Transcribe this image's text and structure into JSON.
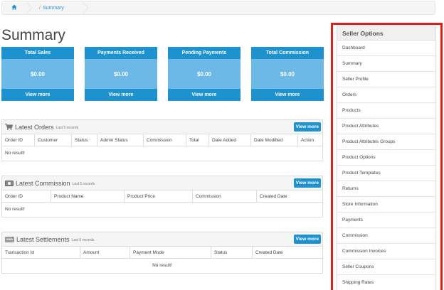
{
  "breadcrumb": {
    "current": "Summary",
    "separator": "/"
  },
  "page": {
    "title": "Summary"
  },
  "tiles": [
    {
      "title": "Total Sales",
      "value": "$0.00",
      "link": "View more"
    },
    {
      "title": "Payments Received",
      "value": "$0.00",
      "link": "View more"
    },
    {
      "title": "Pending Payments",
      "value": "$0.00",
      "link": "View more"
    },
    {
      "title": "Total Commission",
      "value": "$0.00",
      "link": "View more"
    }
  ],
  "orders": {
    "title": "Latest Orders",
    "subtitle": "Last 5 records",
    "button": "View more",
    "columns": [
      "Order ID",
      "Customer",
      "Status",
      "Admin Status",
      "Commission",
      "Total",
      "Date Added",
      "Date Modified",
      "Action"
    ],
    "empty": "No result!"
  },
  "commission": {
    "title": "Latest Commission",
    "subtitle": "Last 5 records",
    "button": "View more",
    "columns": [
      "Order ID",
      "Product Name",
      "Product Price",
      "Commission",
      "Created Date"
    ],
    "empty": "No result!"
  },
  "settlements": {
    "title": "Latest Settlements",
    "subtitle": "Last 5 records",
    "button": "View more",
    "icon_text": "VISA",
    "columns": [
      "Transaction Id",
      "Amount",
      "Payment Mode",
      "Status",
      "Created Date"
    ],
    "empty": "No result!"
  },
  "sidebar": {
    "title": "Seller Options",
    "items": [
      "Dashboard",
      "Summary",
      "Seller Profile",
      "Orders",
      "Products",
      "Product Attributes",
      "Product Attributes Groups",
      "Product Options",
      "Product Templates",
      "Returns",
      "Store Information",
      "Payments",
      "Commission",
      "Commission Invoices",
      "Seller Coupons",
      "Shipping Rates"
    ]
  },
  "colors": {
    "accent": "#1e91cf",
    "tile_body": "#6cb8e6",
    "highlight": "#e41b1b"
  },
  "icons": {
    "home": "home-icon",
    "orders": "cart-icon",
    "commission": "money-icon",
    "settlements": "visa-card-icon"
  }
}
